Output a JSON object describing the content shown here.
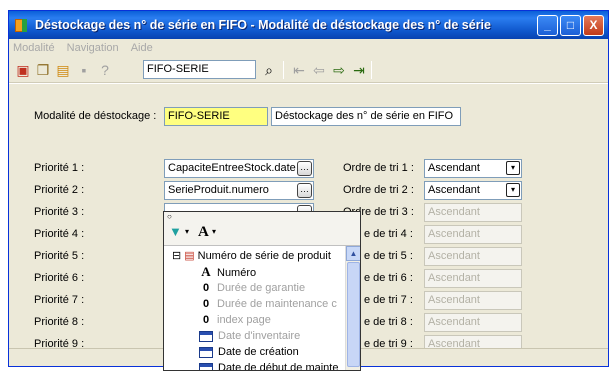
{
  "window": {
    "title": "Déstockage des n° de série en FIFO - Modalité de déstockage des n° de série",
    "minimize": "_",
    "maximize": "□",
    "close": "X"
  },
  "menu": [
    "Modalité",
    "Navigation",
    "Aide"
  ],
  "toolbar": {
    "search_value": "FIFO-SERIE",
    "icons": [
      "new-record-icon",
      "copy-record-icon",
      "paste-record-icon",
      "save-icon",
      "help-icon",
      "search-icon",
      "first-icon",
      "previous-icon",
      "next-icon",
      "last-icon"
    ]
  },
  "form": {
    "modalite_label": "Modalité de déstockage :",
    "modalite_code": "FIFO-SERIE",
    "modalite_desc": "Déstockage des n° de série en FIFO",
    "priorities": [
      {
        "label": "Priorité 1 :",
        "value": "CapaciteEntreeStock.date",
        "ordre_label": "Ordre de tri 1 :",
        "ordre_value": "Ascendant"
      },
      {
        "label": "Priorité 2 :",
        "value": "SerieProduit.numero",
        "ordre_label": "Ordre de tri 2 :",
        "ordre_value": "Ascendant"
      },
      {
        "label": "Priorité 3 :",
        "value": "",
        "ordre_label": "Ordre de tri 3 :",
        "ordre_value": "Ascendant"
      },
      {
        "label": "Priorité 4 :",
        "value": "",
        "ordre_label": "e de tri 4 :",
        "ordre_value": "Ascendant"
      },
      {
        "label": "Priorité 5 :",
        "value": "",
        "ordre_label": "e de tri 5 :",
        "ordre_value": "Ascendant"
      },
      {
        "label": "Priorité 6 :",
        "value": "",
        "ordre_label": "e de tri 6 :",
        "ordre_value": "Ascendant"
      },
      {
        "label": "Priorité 7 :",
        "value": "",
        "ordre_label": "e de tri 7 :",
        "ordre_value": "Ascendant"
      },
      {
        "label": "Priorité 8 :",
        "value": "",
        "ordre_label": "e de tri 8 :",
        "ordre_value": "Ascendant"
      },
      {
        "label": "Priorité 9 :",
        "value": "",
        "ordre_label": "e de tri 9 :",
        "ordre_value": "Ascendant"
      }
    ]
  },
  "popup": {
    "font_glyph": "A",
    "tree": [
      {
        "text": "Numéro de série de produit",
        "icon": "table-icon",
        "enabled": true,
        "indent": 0
      },
      {
        "text": "Numéro",
        "icon": "text-type-icon",
        "enabled": true,
        "indent": 1
      },
      {
        "text": "Durée de garantie",
        "icon": "number-type-icon",
        "enabled": false,
        "indent": 1
      },
      {
        "text": "Durée de maintenance c",
        "icon": "number-type-icon",
        "enabled": false,
        "indent": 1
      },
      {
        "text": "index page",
        "icon": "number-type-icon",
        "enabled": false,
        "indent": 1
      },
      {
        "text": "Date d'inventaire",
        "icon": "date-type-icon",
        "enabled": false,
        "indent": 1
      },
      {
        "text": "Date de création",
        "icon": "date-type-icon",
        "enabled": true,
        "indent": 1
      },
      {
        "text": "Date de début de mainte",
        "icon": "date-type-icon",
        "enabled": true,
        "indent": 1
      }
    ]
  }
}
